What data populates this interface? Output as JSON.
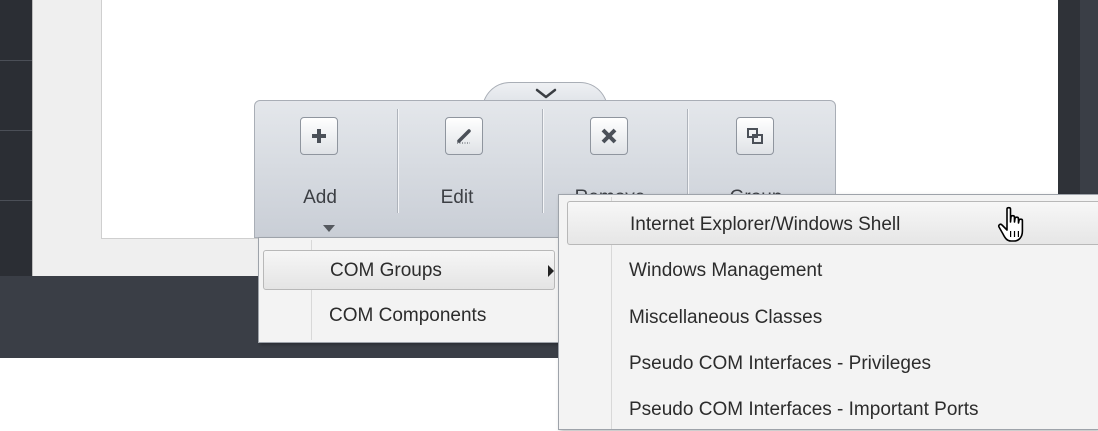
{
  "toolbar": {
    "tools": [
      {
        "label": "Add",
        "icon": "plus-icon"
      },
      {
        "label": "Edit",
        "icon": "pencil-icon"
      },
      {
        "label": "Remove",
        "icon": "x-icon"
      },
      {
        "label": "Group",
        "icon": "group-icon"
      }
    ],
    "collapse_icon": "chevron-down-icon"
  },
  "context_menu": {
    "items": [
      {
        "label": "COM Groups",
        "has_submenu": true,
        "highlighted": true
      },
      {
        "label": "COM Components",
        "has_submenu": false,
        "highlighted": false
      }
    ]
  },
  "submenu": {
    "items": [
      {
        "label": "Internet Explorer/Windows Shell",
        "highlighted": true
      },
      {
        "label": "Windows Management",
        "highlighted": false
      },
      {
        "label": "Miscellaneous Classes",
        "highlighted": false
      },
      {
        "label": "Pseudo COM Interfaces - Privileges",
        "highlighted": false
      },
      {
        "label": "Pseudo COM Interfaces - Important Ports",
        "highlighted": false
      }
    ]
  },
  "colors": {
    "dark_background": "#3a3e46",
    "toolbar": "#d5d9df",
    "menu": "#f3f3f3"
  }
}
